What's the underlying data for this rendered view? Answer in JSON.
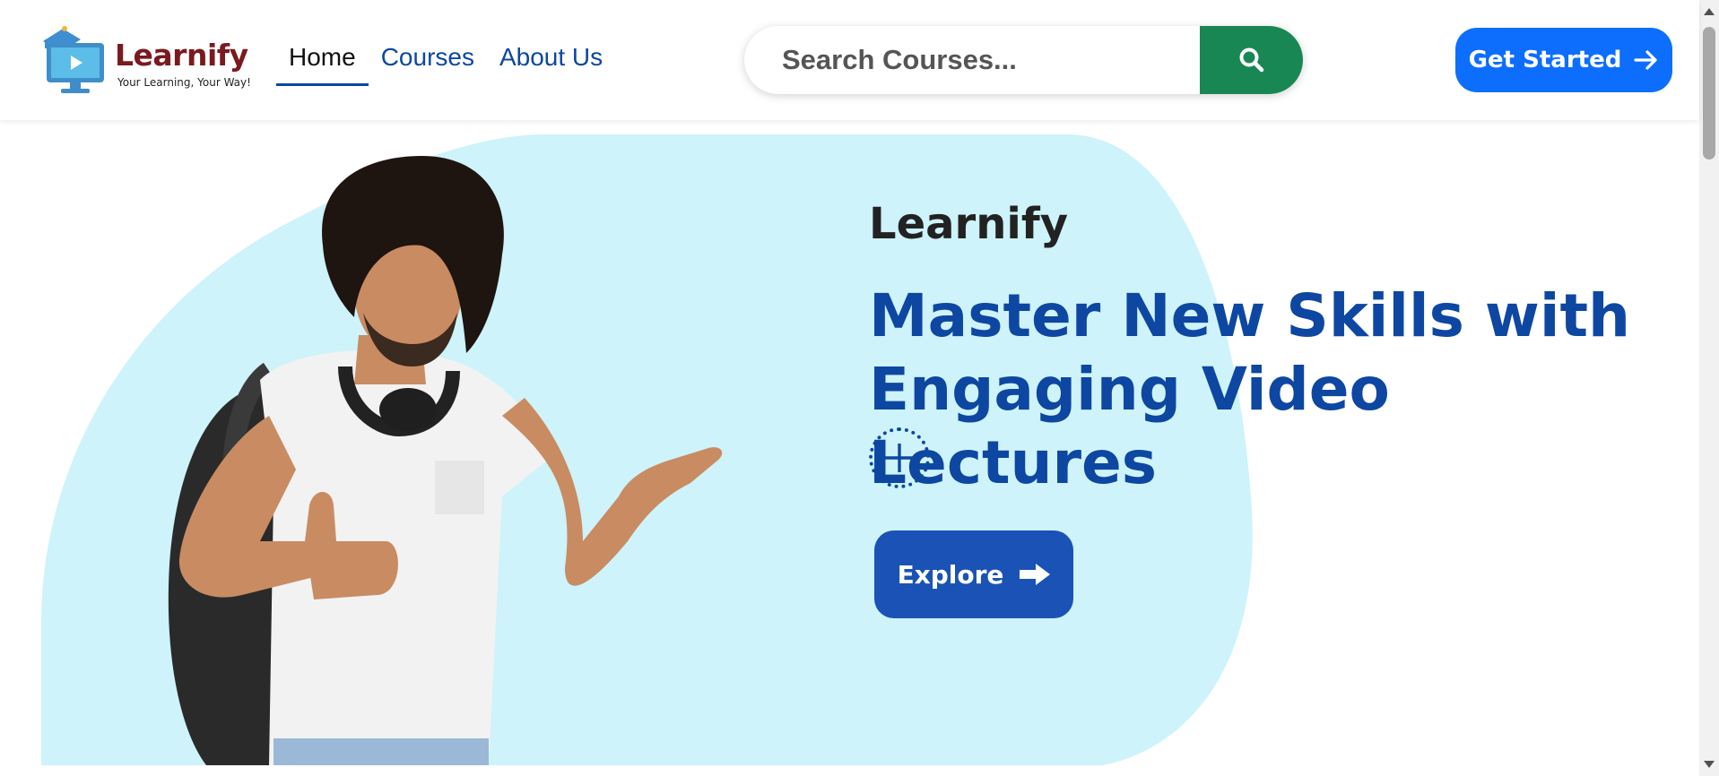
{
  "header": {
    "logo": {
      "name": "Learnify",
      "tagline": "Your Learning, Your Way!"
    },
    "nav": [
      {
        "label": "Home",
        "active": true
      },
      {
        "label": "Courses",
        "active": false
      },
      {
        "label": "About Us",
        "active": false
      }
    ],
    "search": {
      "placeholder": "Search Courses...",
      "value": "",
      "icon": "search-icon"
    },
    "cta": {
      "label": "Get Started",
      "icon": "arrow-right-icon"
    }
  },
  "hero": {
    "brand": "Learnify",
    "headline": "Master New Skills with Engaging Video Lectures",
    "plus_icon": "plus-circle-icon",
    "button": {
      "label": "Explore",
      "icon": "arrow-right-bold-icon"
    },
    "image": "student-pointing-with-backpack"
  },
  "colors": {
    "primary": "#0d6efd",
    "nav_blue": "#0d47a1",
    "search_green": "#198754",
    "hero_blob": "#cef3fa",
    "explore_blue": "#1a53b5",
    "logo_red": "#7a1a1f"
  }
}
